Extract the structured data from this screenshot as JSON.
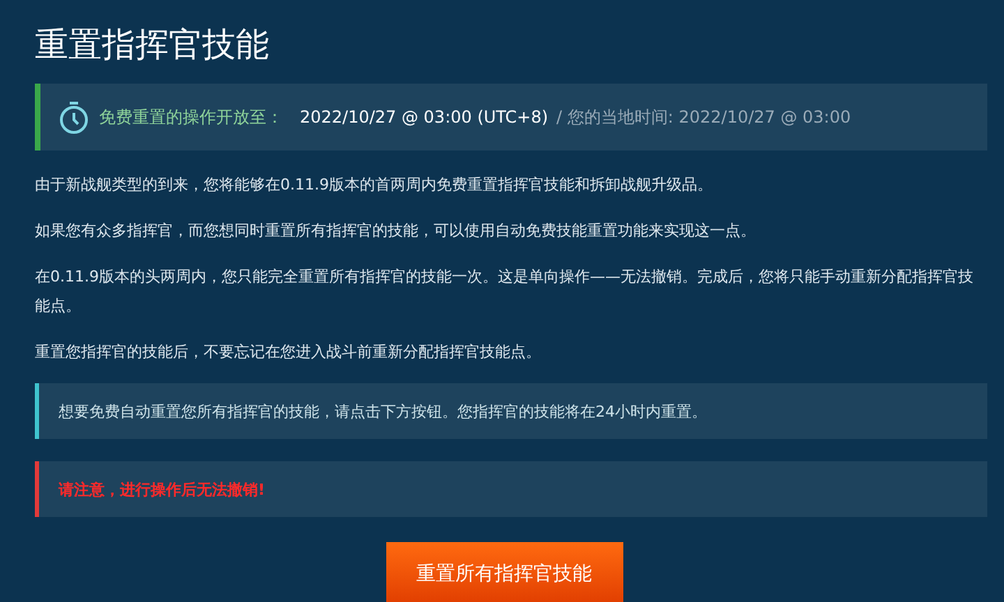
{
  "title": "重置指挥官技能",
  "availability": {
    "label": "免费重置的操作开放至：",
    "server_time": "2022/10/27 @ 03:00 (UTC+8)",
    "local_label": "/ 您的当地时间: 2022/10/27 @ 03:00"
  },
  "paragraphs": [
    "由于新战舰类型的到来，您将能够在0.11.9版本的首两周内免费重置指挥官技能和拆卸战舰升级品。",
    "如果您有众多指挥官，而您想同时重置所有指挥官的技能，可以使用自动免费技能重置功能来实现这一点。",
    "在0.11.9版本的头两周内，您只能完全重置所有指挥官的技能一次。这是单向操作——无法撤销。完成后，您将只能手动重新分配指挥官技能点。",
    "重置您指挥官的技能后，不要忘记在您进入战斗前重新分配指挥官技能点。"
  ],
  "notices": [
    {
      "kind": "info",
      "text": "想要免费自动重置您所有指挥官的技能，请点击下方按钮。您指挥官的技能将在24小时内重置。"
    },
    {
      "kind": "warning",
      "text": "请注意，进行操作后无法撤销!"
    }
  ],
  "button": "重置所有指挥官技能"
}
